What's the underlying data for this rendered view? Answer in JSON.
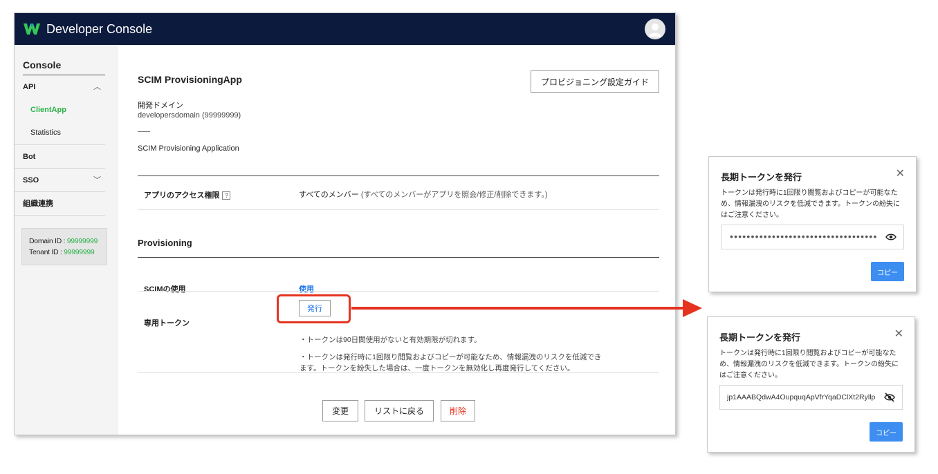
{
  "header": {
    "title": "Developer Console"
  },
  "sidebar": {
    "title": "Console",
    "api": {
      "label": "API",
      "items": [
        {
          "label": "ClientApp"
        },
        {
          "label": "Statistics"
        }
      ]
    },
    "bot": "Bot",
    "sso": "SSO",
    "org": "組織連携",
    "domain_label": "Domain ID : ",
    "domain_value": "99999999",
    "tenant_label": "Tenant ID : ",
    "tenant_value": "99999999"
  },
  "main": {
    "app_name": "SCIM ProvisioningApp",
    "guide_button": "プロビジョニング設定ガイド",
    "domain_label": "開発ドメイン",
    "domain_value": "developersdomain (99999999)",
    "description": "SCIM Provisioning Application",
    "access_label": "アプリのアクセス権限",
    "access_help": "?",
    "access_value": "すべてのメンバー",
    "access_detail": " (すべてのメンバーがアプリを照会/修正/削除できます。)",
    "provisioning_title": "Provisioning",
    "scim_label": "SCIMの使用",
    "scim_value": "使用",
    "token_label": "専用トークン",
    "issue_button": "発行",
    "note1": "・トークンは90日間使用がないと有効期限が切れます。",
    "note2": "・トークンは発行時に1回限り閲覧およびコピーが可能なため、情報漏洩のリスクを低減できます。トークンを紛失した場合は、一度トークンを無効化し再度発行してください。",
    "buttons": {
      "change": "変更",
      "back": "リストに戻る",
      "delete": "削除"
    }
  },
  "dialogs": [
    {
      "title": "長期トークンを発行",
      "body": "トークンは発行時に1回限り閲覧およびコピーが可能なため、情報漏洩のリスクを低減できます。トークンの紛失にはご注意ください。",
      "token_masked": "•••••••••••••••••••••••••••••••••••",
      "copy_button": "コピー"
    },
    {
      "title": "長期トークンを発行",
      "body": "トークンは発行時に1回限り閲覧およびコピーが可能なため、情報漏洩のリスクを低減できます。トークンの紛失にはご注意ください。",
      "token_value": "jp1AAABQdwA4OupquqApVfrYqaDClXt2Ryllp",
      "copy_button": "コピー"
    }
  ],
  "colors": {
    "header_bg": "#0b1a3d",
    "accent_green": "#2db24a",
    "link_blue": "#1a73e8",
    "highlight_red": "#e5331f",
    "copy_blue": "#3d8ef0"
  }
}
